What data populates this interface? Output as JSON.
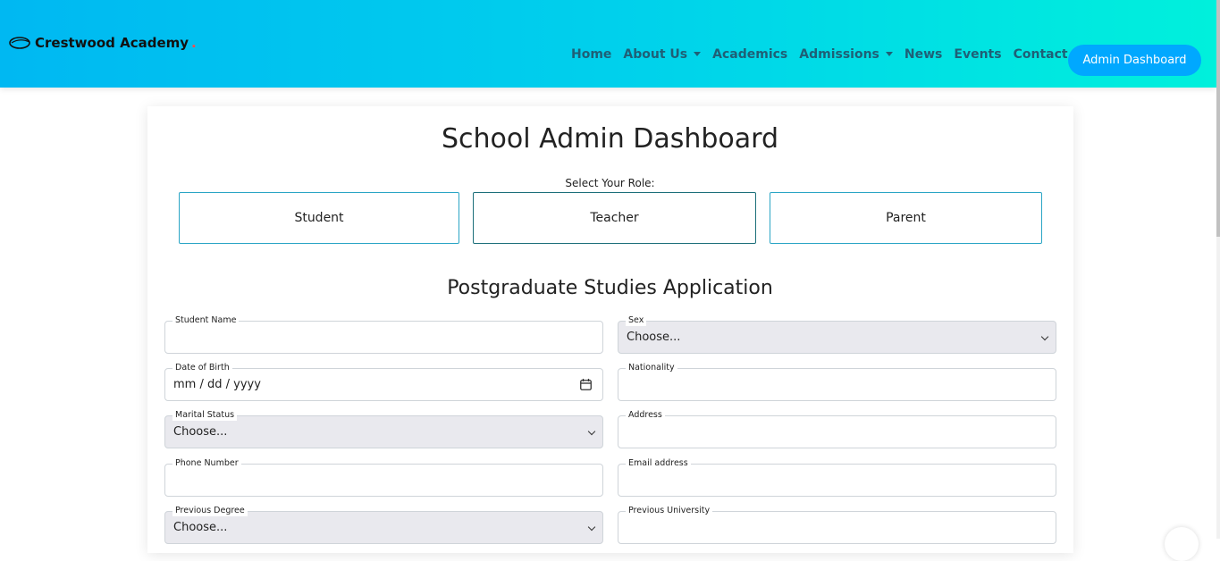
{
  "header": {
    "brand": "Crestwood Academy",
    "brand_dot": ".",
    "nav": [
      {
        "label": "Home"
      },
      {
        "label": "About Us",
        "dropdown": true
      },
      {
        "label": "Academics"
      },
      {
        "label": "Admissions",
        "dropdown": true
      },
      {
        "label": "News"
      },
      {
        "label": "Events"
      },
      {
        "label": "Contact Us"
      }
    ],
    "cta": "Admin Dashboard"
  },
  "main": {
    "title": "School Admin Dashboard",
    "role_label": "Select Your Role:",
    "roles": [
      "Student",
      "Teacher",
      "Parent"
    ],
    "form_title": "Postgraduate Studies Application",
    "fields": {
      "student_name": {
        "label": "Student Name",
        "value": ""
      },
      "sex": {
        "label": "Sex",
        "value": "Choose..."
      },
      "dob": {
        "label": "Date of Birth",
        "placeholder": "mm / dd / yyyy"
      },
      "nationality": {
        "label": "Nationality",
        "value": ""
      },
      "marital_status": {
        "label": "Marital Status",
        "value": "Choose..."
      },
      "address": {
        "label": "Address",
        "value": ""
      },
      "phone": {
        "label": "Phone Number",
        "value": ""
      },
      "email": {
        "label": "Email address",
        "value": ""
      },
      "previous_degree": {
        "label": "Previous Degree",
        "value": "Choose..."
      },
      "previous_university": {
        "label": "Previous University",
        "value": ""
      }
    }
  },
  "colors": {
    "header_start": "#00b8f2",
    "header_end": "#00f0dc",
    "nav_text": "#1f5f76",
    "cta_bg": "#00a8ff",
    "role_border": "#2aa5c5"
  },
  "icons": [
    "crescent-logo-icon",
    "calendar-icon",
    "chevron-down-icon",
    "caret-down-icon"
  ]
}
